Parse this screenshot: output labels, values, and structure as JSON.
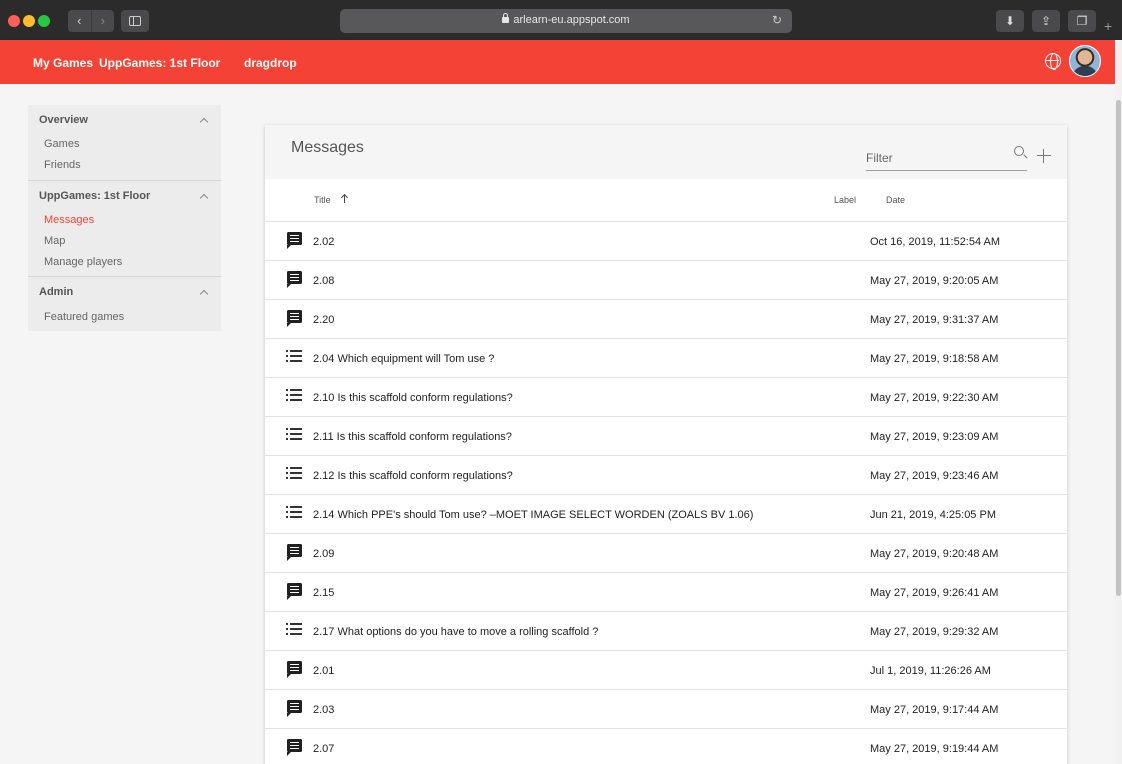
{
  "browser": {
    "url": "arlearn-eu.appspot.com",
    "nav_back": "‹",
    "nav_forward": "›",
    "reload": "↻",
    "new_tab": "+"
  },
  "header": {
    "nav": [
      "My Games",
      "UppGames: 1st Floor",
      "dragdrop"
    ],
    "accent_color": "#f44336"
  },
  "sidebar": {
    "sections": [
      {
        "title": "Overview",
        "items": [
          "Games",
          "Friends"
        ]
      },
      {
        "title": "UppGames: 1st Floor",
        "items": [
          "Messages",
          "Map",
          "Manage players"
        ]
      },
      {
        "title": "Admin",
        "items": [
          "Featured games"
        ]
      }
    ],
    "active_item": "Messages"
  },
  "messages": {
    "title": "Messages",
    "filter_placeholder": "Filter",
    "columns": {
      "title": "Title",
      "label": "Label",
      "date": "Date"
    },
    "sort": "title-ascending",
    "rows": [
      {
        "icon": "message-icon",
        "title": "2.02",
        "label": "",
        "date": "Oct 16, 2019, 11:52:54 AM"
      },
      {
        "icon": "message-icon",
        "title": "2.08",
        "label": "",
        "date": "May 27, 2019, 9:20:05 AM"
      },
      {
        "icon": "message-icon",
        "title": "2.20",
        "label": "",
        "date": "May 27, 2019, 9:31:37 AM"
      },
      {
        "icon": "list-icon",
        "title": "2.04 Which equipment will Tom use ?",
        "label": "",
        "date": "May 27, 2019, 9:18:58 AM"
      },
      {
        "icon": "list-icon",
        "title": "2.10 Is this scaffold conform regulations?",
        "label": "",
        "date": "May 27, 2019, 9:22:30 AM"
      },
      {
        "icon": "list-icon",
        "title": "2.11 Is this scaffold conform regulations?",
        "label": "",
        "date": "May 27, 2019, 9:23:09 AM"
      },
      {
        "icon": "list-icon",
        "title": "2.12 Is this scaffold conform regulations?",
        "label": "",
        "date": "May 27, 2019, 9:23:46 AM"
      },
      {
        "icon": "list-icon",
        "title": "2.14 Which PPE's should Tom use? –MOET IMAGE SELECT WORDEN (ZOALS BV 1.06)",
        "label": "",
        "date": "Jun 21, 2019, 4:25:05 PM"
      },
      {
        "icon": "message-icon",
        "title": "2.09",
        "label": "",
        "date": "May 27, 2019, 9:20:48 AM"
      },
      {
        "icon": "message-icon",
        "title": "2.15",
        "label": "",
        "date": "May 27, 2019, 9:26:41 AM"
      },
      {
        "icon": "list-icon",
        "title": "2.17 What options do you have to move a rolling scaffold ?",
        "label": "",
        "date": "May 27, 2019, 9:29:32 AM"
      },
      {
        "icon": "message-icon",
        "title": "2.01",
        "label": "",
        "date": "Jul 1, 2019, 11:26:26 AM"
      },
      {
        "icon": "message-icon",
        "title": "2.03",
        "label": "",
        "date": "May 27, 2019, 9:17:44 AM"
      },
      {
        "icon": "message-icon",
        "title": "2.07",
        "label": "",
        "date": "May 27, 2019, 9:19:44 AM"
      }
    ]
  }
}
